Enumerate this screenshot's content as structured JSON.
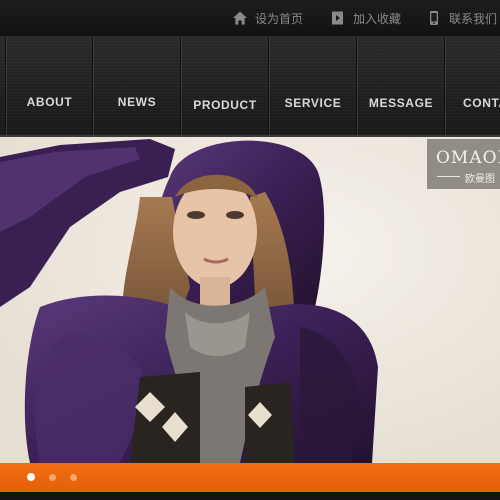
{
  "topbar": {
    "items": [
      {
        "label": "设为首页",
        "icon": "home-icon"
      },
      {
        "label": "加入收藏",
        "icon": "bookmark-add-icon"
      },
      {
        "label": "联系我们",
        "icon": "phone-icon"
      }
    ]
  },
  "nav": {
    "items": [
      {
        "label": "ABOUT"
      },
      {
        "label": "NEWS"
      },
      {
        "label": "PRODUCT"
      },
      {
        "label": "SERVICE"
      },
      {
        "label": "MESSAGE"
      },
      {
        "label": "CONTA"
      }
    ]
  },
  "banner": {
    "brand_name": "OMAON",
    "brand_sub": "欧曼图",
    "slides_total": 3,
    "active_slide": 1
  },
  "colors": {
    "accent_orange": "#f26d10",
    "header_dark": "#1d1d1d",
    "jacket_purple": "#3e2357"
  }
}
